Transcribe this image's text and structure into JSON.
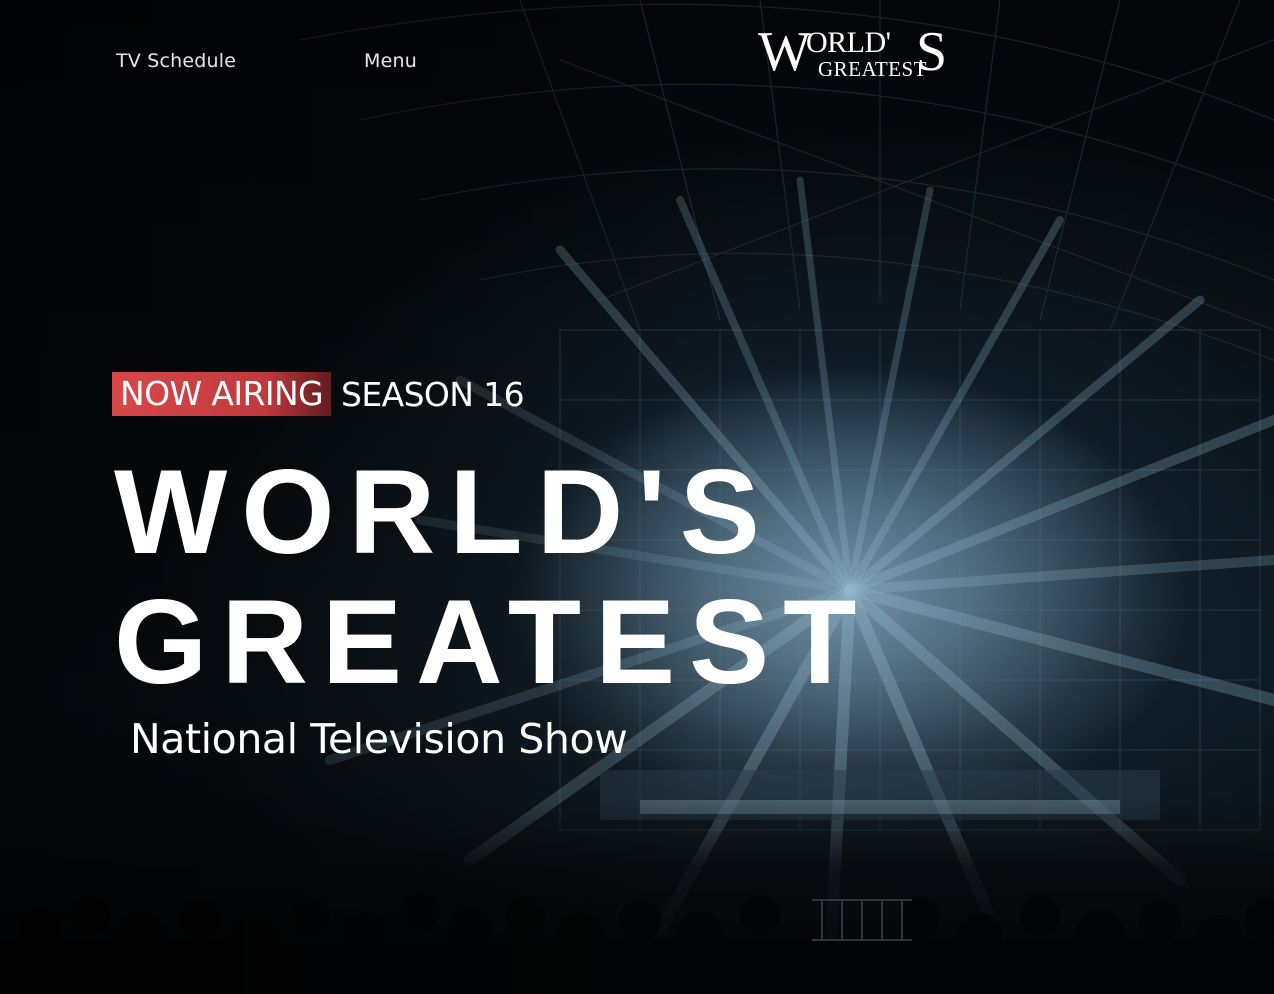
{
  "header": {
    "nav_schedule": "TV Schedule",
    "nav_menu": "Menu",
    "logo": {
      "first_letter": "W",
      "rest_top": "ORLD'",
      "last_letter": "S",
      "bottom": "GREATEST",
      "accessible_text": "WORLD'S GREATEST"
    }
  },
  "hero": {
    "badge": "NOW AIRING",
    "season": "SEASON 16",
    "title_line1": "WORLD'S",
    "title_line2": "GREATEST",
    "subtitle": "National Television Show",
    "background_image": "concert-stage-light-beams"
  },
  "colors": {
    "background": "#05080b",
    "badge_red": "#d8484a",
    "text": "#ffffff",
    "light_beams": "#9fc4d8"
  }
}
